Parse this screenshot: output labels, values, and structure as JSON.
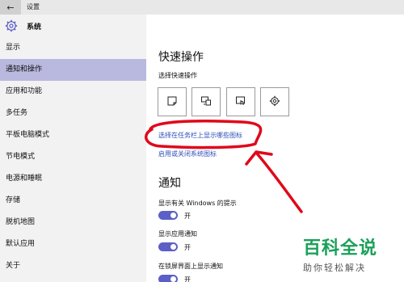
{
  "window": {
    "title": "设置",
    "back_symbol": "←"
  },
  "sidebar": {
    "header": "系统",
    "items": [
      {
        "label": "显示"
      },
      {
        "label": "通知和操作",
        "active": true
      },
      {
        "label": "应用和功能"
      },
      {
        "label": "多任务"
      },
      {
        "label": "平板电脑模式"
      },
      {
        "label": "节电模式"
      },
      {
        "label": "电源和睡眠"
      },
      {
        "label": "存储"
      },
      {
        "label": "脱机地图"
      },
      {
        "label": "默认应用"
      },
      {
        "label": "关于"
      }
    ]
  },
  "quick_actions": {
    "title": "快速操作",
    "subtitle": "选择快速操作",
    "tiles": [
      "note-icon",
      "connect-screen-icon",
      "tablet-touch-icon",
      "settings-gear-icon"
    ],
    "link_taskbar_icons": "选择在任务栏上显示哪些图标",
    "link_system_icons": "启用或关闭系统图标"
  },
  "notifications": {
    "title": "通知",
    "toggles": [
      {
        "label": "显示有关 Windows 的提示",
        "state": "开"
      },
      {
        "label": "显示应用通知",
        "state": "开"
      },
      {
        "label": "在锁屏界面上显示通知",
        "state": "开"
      }
    ]
  },
  "watermark": {
    "big": "百科全说",
    "small": "助你轻松解决"
  },
  "colors": {
    "accent": "#5b5fc7",
    "active_item": "#b9b8df",
    "link": "#2d4eb8",
    "annotation": "#e0081a",
    "watermark": "#1aa05a"
  }
}
